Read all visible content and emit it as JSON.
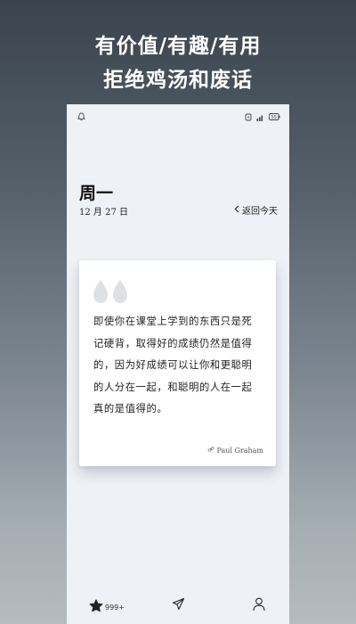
{
  "promo": {
    "line1": "有价值/有趣/有用",
    "line2": "拒绝鸡汤和废话"
  },
  "status_bar": {
    "left_icon": "bell-icon",
    "right_icons": [
      "alarm-icon",
      "signal-icon",
      "battery-icon"
    ],
    "battery_level": "55"
  },
  "header": {
    "weekday": "周一",
    "date": "12 月 27 日",
    "back_today_label": "返回今天"
  },
  "quote": {
    "text": "即使你在课堂上学到的东西只是死记硬背，取得好的成绩仍然是值得的，因为好成绩可以让你和更聪明的人分在一起，和聪明的人在一起真的是值得的。",
    "author": "Paul Graham"
  },
  "bottom_nav": {
    "favorite_count": "999+",
    "items": [
      "star-icon",
      "send-icon",
      "user-icon"
    ]
  },
  "colors": {
    "screen_bg": "#eef1f5",
    "card_bg": "#ffffff",
    "quote_mark": "#dde1e6",
    "text": "#222222"
  }
}
